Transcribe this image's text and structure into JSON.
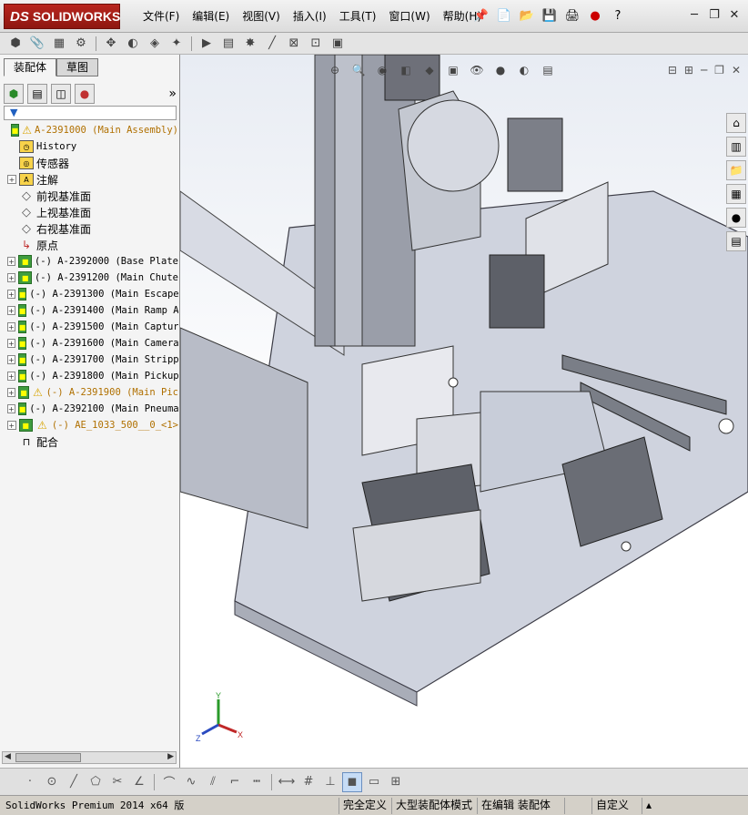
{
  "app": {
    "logo_prefix": "DS",
    "logo_text": "SOLIDWORKS"
  },
  "menu": [
    "文件(F)",
    "编辑(E)",
    "视图(V)",
    "插入(I)",
    "工具(T)",
    "窗口(W)",
    "帮助(H)"
  ],
  "tabs": [
    "装配体",
    "草图"
  ],
  "tree": {
    "root": "A-2391000 (Main Assembly)",
    "items": [
      {
        "label": "History",
        "icon": "history-icon"
      },
      {
        "label": "传感器",
        "icon": "sensor-icon"
      },
      {
        "label": "注解",
        "icon": "annotation-icon"
      },
      {
        "label": "前视基准面",
        "icon": "plane-icon"
      },
      {
        "label": "上视基准面",
        "icon": "plane-icon"
      },
      {
        "label": "右视基准面",
        "icon": "plane-icon"
      },
      {
        "label": "原点",
        "icon": "origin-icon"
      },
      {
        "label": "(-) A-2392000 (Base Plate",
        "icon": "assembly-icon"
      },
      {
        "label": "(-) A-2391200 (Main Chute",
        "icon": "assembly-icon"
      },
      {
        "label": "(-) A-2391300 (Main Escape",
        "icon": "assembly-icon"
      },
      {
        "label": "(-) A-2391400 (Main Ramp A",
        "icon": "assembly-icon"
      },
      {
        "label": "(-) A-2391500 (Main Captur",
        "icon": "assembly-icon"
      },
      {
        "label": "(-) A-2391600 (Main Camera",
        "icon": "assembly-icon"
      },
      {
        "label": "(-) A-2391700 (Main Stripp",
        "icon": "assembly-icon"
      },
      {
        "label": "(-) A-2391800 (Main Pickup",
        "icon": "assembly-icon"
      },
      {
        "label": "(-) A-2391900 (Main Pic",
        "icon": "assembly-warning-icon"
      },
      {
        "label": "(-) A-2392100 (Main Pneuma",
        "icon": "assembly-icon"
      },
      {
        "label": "(-) AE_1033_500__0_<1>",
        "icon": "assembly-warning-icon"
      },
      {
        "label": "配合",
        "icon": "mates-icon"
      }
    ]
  },
  "triad": {
    "x": "X",
    "y": "Y",
    "z": "Z"
  },
  "status": {
    "product": "SolidWorks Premium 2014 x64 版",
    "definition": "完全定义",
    "mode": "大型装配体模式",
    "editing": "在编辑 装配体",
    "units": "自定义"
  },
  "colors": {
    "brand": "#b8261f",
    "tree_top": "#b07000",
    "viewport_top": "#e8ecf3"
  }
}
